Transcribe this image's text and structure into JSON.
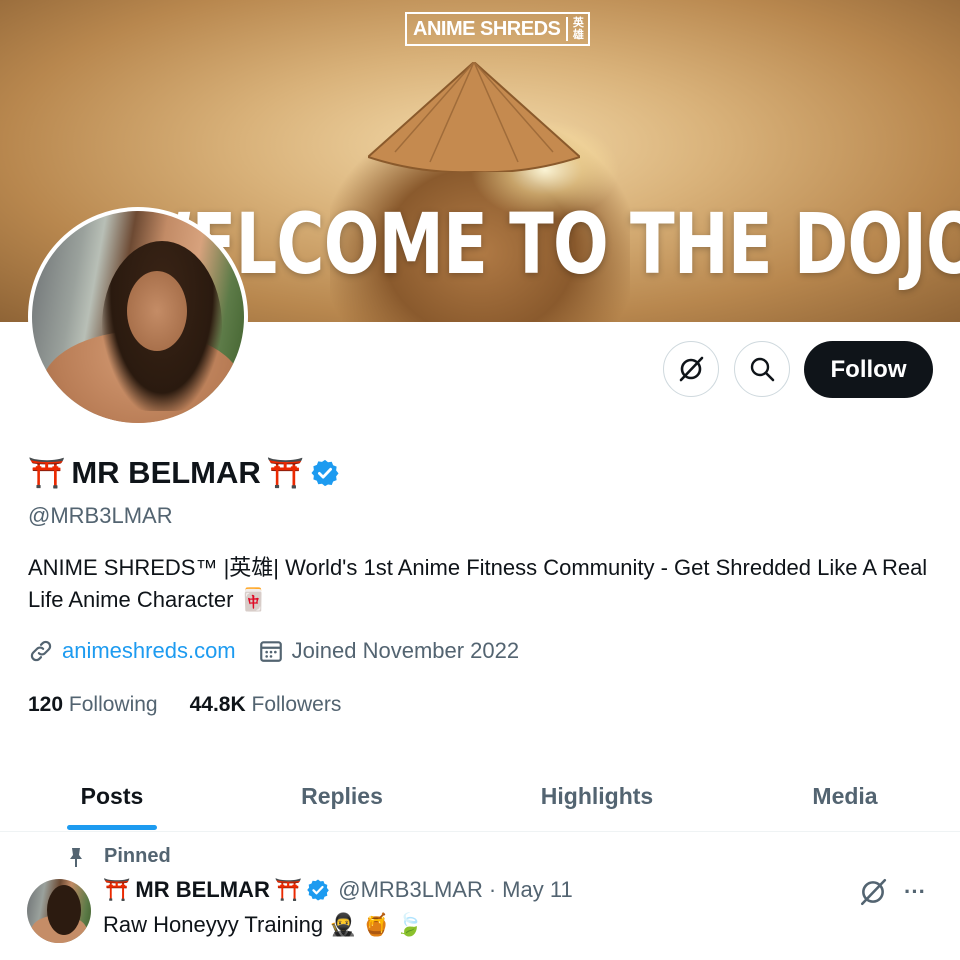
{
  "banner": {
    "logo_text": "ANIME SHREDS",
    "logo_kanji": "英雄",
    "headline": "WELCOME TO THE DOJO"
  },
  "actions": {
    "grok_icon": "grok-icon",
    "search_icon": "search-icon",
    "follow_label": "Follow"
  },
  "profile": {
    "name": "MR BELMAR",
    "left_emoji": "⛩️",
    "right_emoji": "⛩️",
    "verified": true,
    "handle": "@MRB3LMAR",
    "bio": "ANIME SHREDS™ |英雄| World's 1st Anime Fitness Community - Get Shredded Like A Real Life Anime Character 🀄",
    "website": "animeshreds.com",
    "joined": "Joined November 2022",
    "following_count": "120",
    "following_label": "Following",
    "followers_count": "44.8K",
    "followers_label": "Followers"
  },
  "tabs": [
    {
      "label": "Posts",
      "active": true
    },
    {
      "label": "Replies",
      "active": false
    },
    {
      "label": "Highlights",
      "active": false
    },
    {
      "label": "Media",
      "active": false
    }
  ],
  "pinned_post": {
    "pinned_label": "Pinned",
    "author_name": "MR BELMAR",
    "handle": "@MRB3LMAR",
    "separator": "·",
    "date": "May 11",
    "text": "Raw Honeyyy Training",
    "emojis": [
      "🥷",
      "🍯",
      "🍃"
    ],
    "more_label": "···"
  },
  "colors": {
    "accent": "#1d9bf0",
    "text_primary": "#0f1419",
    "text_secondary": "#536471",
    "follow_bg": "#0f1419",
    "verified": "#1d9bf0"
  }
}
